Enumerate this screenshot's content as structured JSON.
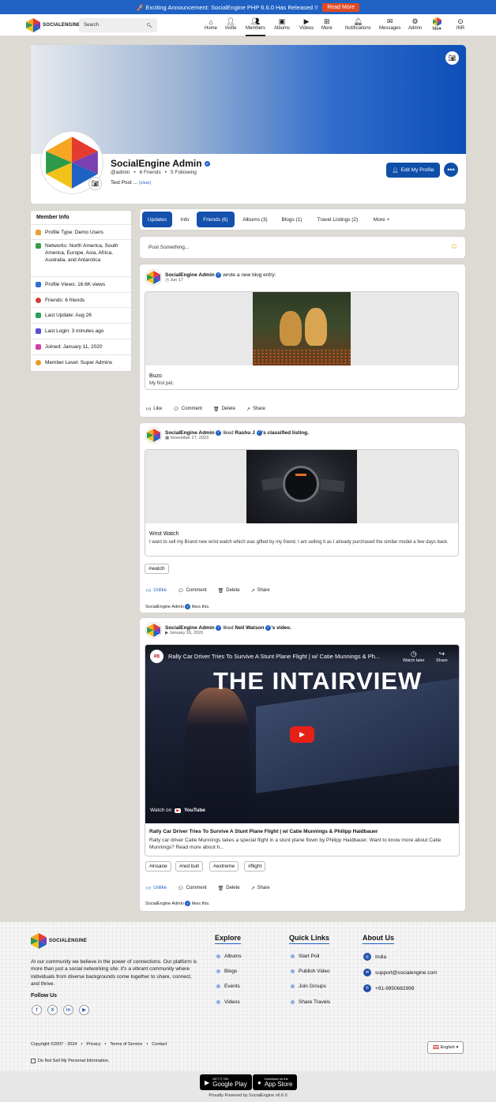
{
  "announcement": {
    "text": "🚀 Exciting Announcement: SocialEngine PHP 6.6.0 Has Released !!",
    "button": "Read More"
  },
  "header": {
    "logo": "SOCIALENGINE",
    "search_placeholder": "Search",
    "nav": [
      {
        "label": "Home",
        "icon": "home-icon"
      },
      {
        "label": "Invite",
        "icon": "invite-icon"
      },
      {
        "label": "Members",
        "icon": "members-icon",
        "active": true
      },
      {
        "label": "Albums",
        "icon": "albums-icon"
      },
      {
        "label": "Videos",
        "icon": "videos-icon"
      },
      {
        "label": "More",
        "icon": "more-icon"
      },
      {
        "label": "Notifications",
        "icon": "bell-icon"
      },
      {
        "label": "Messages",
        "icon": "mail-icon"
      },
      {
        "label": "Admin",
        "icon": "gear-icon"
      },
      {
        "label": "Me",
        "icon": "user-avatar-icon"
      },
      {
        "label": "INR",
        "icon": "currency-icon"
      }
    ]
  },
  "profile": {
    "name": "SocialEngine Admin",
    "username": "@admin",
    "friends": "6 Friends",
    "following": "5 Following",
    "status": "Test Post ...",
    "clear": "(clear)",
    "edit_button": "Edit My Profile"
  },
  "member_info": {
    "title": "Member Info",
    "items": [
      {
        "text": "Profile Type: Demo Users",
        "color": "#e8a13a"
      },
      {
        "text": "Networks: North America, South America, Europe, Asia, Africa, Australia, and Antarctica",
        "color": "#3a9a4a"
      },
      {
        "text": "Profile Views: 16.6K views",
        "color": "#2f6fd0"
      },
      {
        "text": "Friends: 6 friends",
        "color": "#d23b3b"
      },
      {
        "text": "Last Update: Aug 26",
        "color": "#2aa15a"
      },
      {
        "text": "Last Login: 3 minutes ago",
        "color": "#5a4fd0"
      },
      {
        "text": "Joined: January 11, 2020",
        "color": "#d13fa8"
      },
      {
        "text": "Member Level: Super Admins",
        "color": "#e69a22"
      }
    ]
  },
  "tabs": [
    {
      "label": "Updates",
      "active": true
    },
    {
      "label": "Info"
    },
    {
      "label": "Friends (6)",
      "active": true
    },
    {
      "label": "Albums (3)"
    },
    {
      "label": "Blogs (1)"
    },
    {
      "label": "Travel Listings (2)"
    },
    {
      "label": "More +"
    }
  ],
  "composer": {
    "placeholder": "Post Something..."
  },
  "posts": [
    {
      "author": "SocialEngine Admin",
      "action": "wrote a new blog entry:",
      "date": "Jun 17",
      "title": "Buzo",
      "desc": "My first pet.",
      "actions": [
        "Like",
        "Comment",
        "Delete",
        "Share"
      ]
    },
    {
      "author": "SocialEngine Admin",
      "action": "liked",
      "target": "Rashu J",
      "suffix": "'s classified listing.",
      "date": "November 27, 2023",
      "title": "Wrist Watch",
      "desc": "I want to sell my Brand new wrist watch which was gifted by my friend. I am selling it as I already purchased the similar model a few days back.",
      "tags": [
        "#watch"
      ],
      "actions": [
        "Unlike",
        "Comment",
        "Delete",
        "Share"
      ],
      "likes": "SocialEngine Admin",
      "likes_suffix": "likes this."
    },
    {
      "author": "SocialEngine Admin",
      "action": "liked",
      "target": "Neil Watson",
      "suffix": "'s video.",
      "date": "January 16, 2020",
      "video_title": "Rally Car Driver Tries To Survive A Stunt Plane Flight | w/ Catie Munnings & Ph...",
      "video_overlay": "THE INTAIRVIEW",
      "watch_later": "Watch later",
      "share": "Share",
      "watch_on": "Watch on",
      "youtube": "YouTube",
      "title": "Rally Car Driver Tries To Survive A Stunt Plane Flight | w/ Catie Munnings & Philipp Haidbauer",
      "desc": "Rally car driver Catie Munnings takes a special flight in a stunt plane flown by Philipp Haidbauer. Want to know more about Catie Munnings? Read more about h...",
      "tags": [
        "#insane",
        "#red bull",
        "#extreme",
        "#flight"
      ],
      "actions": [
        "Unlike",
        "Comment",
        "Delete",
        "Share"
      ],
      "likes": "SocialEngine Admin",
      "likes_suffix": "likes this."
    }
  ],
  "footer": {
    "logo": "SOCIALENGINE",
    "about": "At our community we believe in the power of connections. Our platform is more than just a social networking site; it's a vibrant community where individuals from diverse backgrounds come together to share, connect, and thrive.",
    "follow": "Follow Us",
    "social": [
      "f",
      "X",
      "in",
      "▶"
    ],
    "explore": {
      "title": "Explore",
      "links": [
        "Albums",
        "Blogs",
        "Events",
        "Videos"
      ]
    },
    "quick": {
      "title": "Quick Links",
      "links": [
        "Start Poll",
        "Publish Video",
        "Join Groups",
        "Share Travels"
      ]
    },
    "aboutus": {
      "title": "About Us",
      "items": [
        "India",
        "support@socialengine.com",
        "+91-9950682999"
      ]
    },
    "copyright": "Copyright ©2007 - 2024",
    "links": [
      "Privacy",
      "Terms of Service",
      "Contact"
    ],
    "language": "English",
    "dnsmpi": "Do Not Sell My Personal Information.",
    "google_play": "Google Play",
    "google_small": "GET IT ON",
    "app_store": "App Store",
    "app_small": "Download on the",
    "powered": "Proudly Powered by SocialEngine v6.6.0"
  }
}
